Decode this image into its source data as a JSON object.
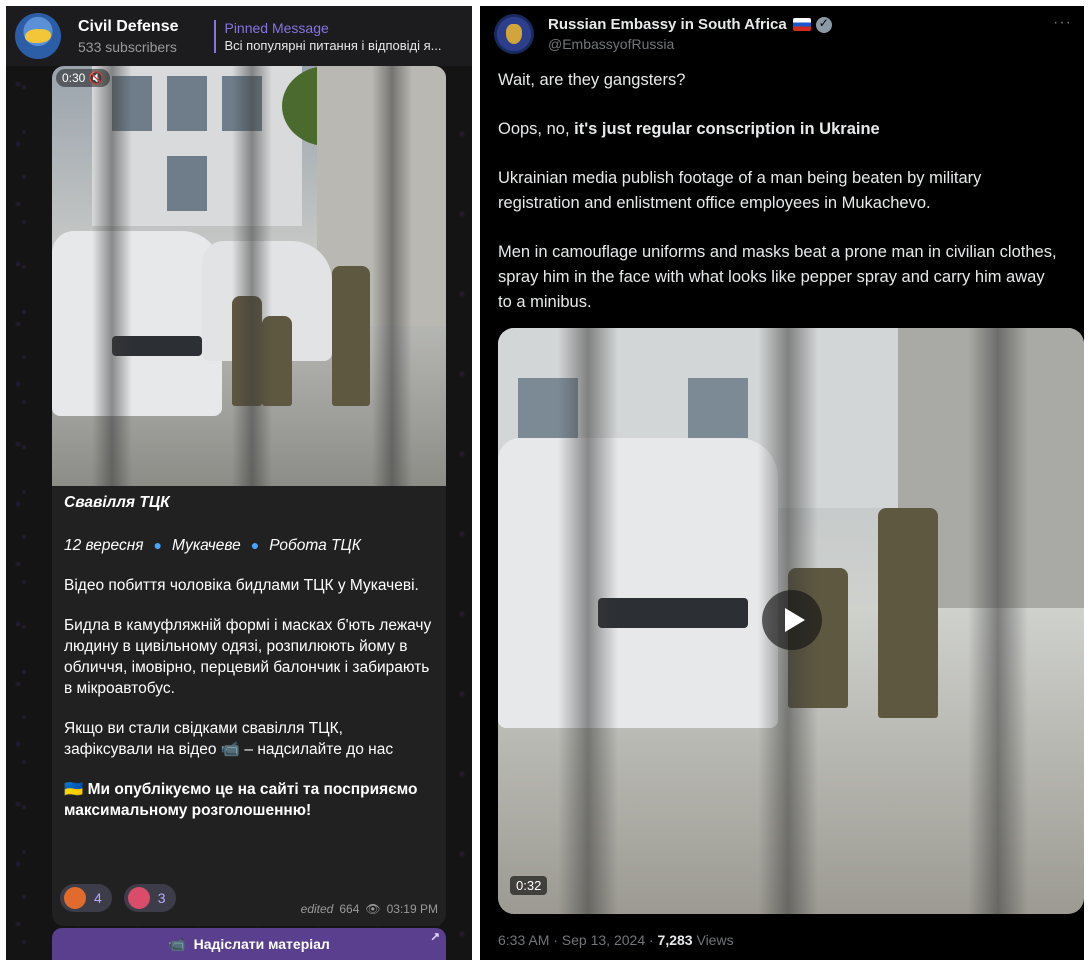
{
  "telegram": {
    "channel_title": "Civil Defense",
    "subscribers": "533 subscribers",
    "pinned_label": "Pinned Message",
    "pinned_text": "Всі популярні питання і відповіді я...",
    "video_badge": "0:30 🔇",
    "heading": "Свавілля ТЦК",
    "tags": [
      "12 вересня",
      "Мукачеве",
      "Робота ТЦК"
    ],
    "paragraphs": [
      "Відео побиття чоловіка бидлами ТЦК у Мукачеві.",
      "Бидла в камуфляжній формі і масках б'ють лежачу людину в цивільному одязі, розпилюють йому в обличчя, імовірно, перцевий балончик і забирають в мікроавтобус.",
      "Якщо ви стали свідками свавілля ТЦК, зафіксували на відео 📹 – надсилайте до нас"
    ],
    "bold_paragraph": "Ми опублікуємо це на сайті та посприяємо максимальному розголошенню!",
    "reactions": [
      {
        "count": "4"
      },
      {
        "count": "3"
      }
    ],
    "meta": {
      "edited": "edited",
      "views": "664",
      "time": "03:19 PM"
    },
    "send_button": "Надіслати матеріал",
    "icons": {
      "avatar": "channel-avatar",
      "pin": "pin-icon",
      "views": "eye-icon",
      "send": "video-camera-icon"
    }
  },
  "x_post": {
    "name": "Russian Embassy in South Africa",
    "handle": "@EmbassyofRussia",
    "more": "···",
    "line1": "Wait, are they gangsters?",
    "line2_prefix": "Oops, no, ",
    "line2_bold": "it's just regular conscription in Ukraine",
    "paragraph3": "Ukrainian media publish footage of a man being beaten by military registration and enlistment office employees in Mukachevo.",
    "paragraph4": "Men in camouflage uniforms and masks beat a prone man in civilian clothes, spray him in the face with what looks like pepper spray and carry him away to a minibus.",
    "video_time": "0:32",
    "footer_time": "6:33 AM · Sep 13, 2024 · ",
    "views_count": "7,283",
    "views_label": " Views",
    "colors": {
      "text": "#e7e9ea",
      "muted": "#71767b",
      "background": "#000000"
    }
  }
}
